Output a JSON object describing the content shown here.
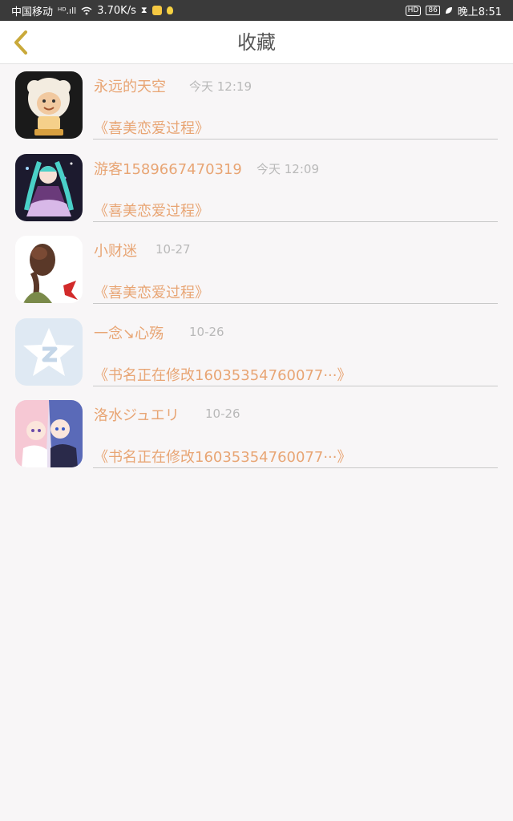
{
  "status_bar": {
    "carrier": "中国移动",
    "signal": "ᴴᴰ.ıll",
    "speed": "3.70K/s",
    "hd_badge": "HD",
    "battery": "86",
    "time": "晚上8:51"
  },
  "header": {
    "title": "收藏"
  },
  "items": [
    {
      "name": "永远的天空",
      "time": "今天 12:19",
      "book": "《喜美恋爱过程》"
    },
    {
      "name": "游客1589667470319",
      "time": "今天 12:09",
      "book": "《喜美恋爱过程》"
    },
    {
      "name": "小财迷",
      "time": "10-27",
      "book": "《喜美恋爱过程》"
    },
    {
      "name": "一念↘心殇",
      "time": "10-26",
      "book": "《书名正在修改16035354760077···》"
    },
    {
      "name": "洛水ジュエリ",
      "time": "10-26",
      "book": "《书名正在修改16035354760077···》"
    }
  ],
  "colors": {
    "accent": "#e8a574",
    "back_arrow": "#c9a93a",
    "timestamp": "#b9b9b9"
  },
  "icons": {
    "back": "chevron-left-icon",
    "default_avatar": "qq-star-icon"
  }
}
